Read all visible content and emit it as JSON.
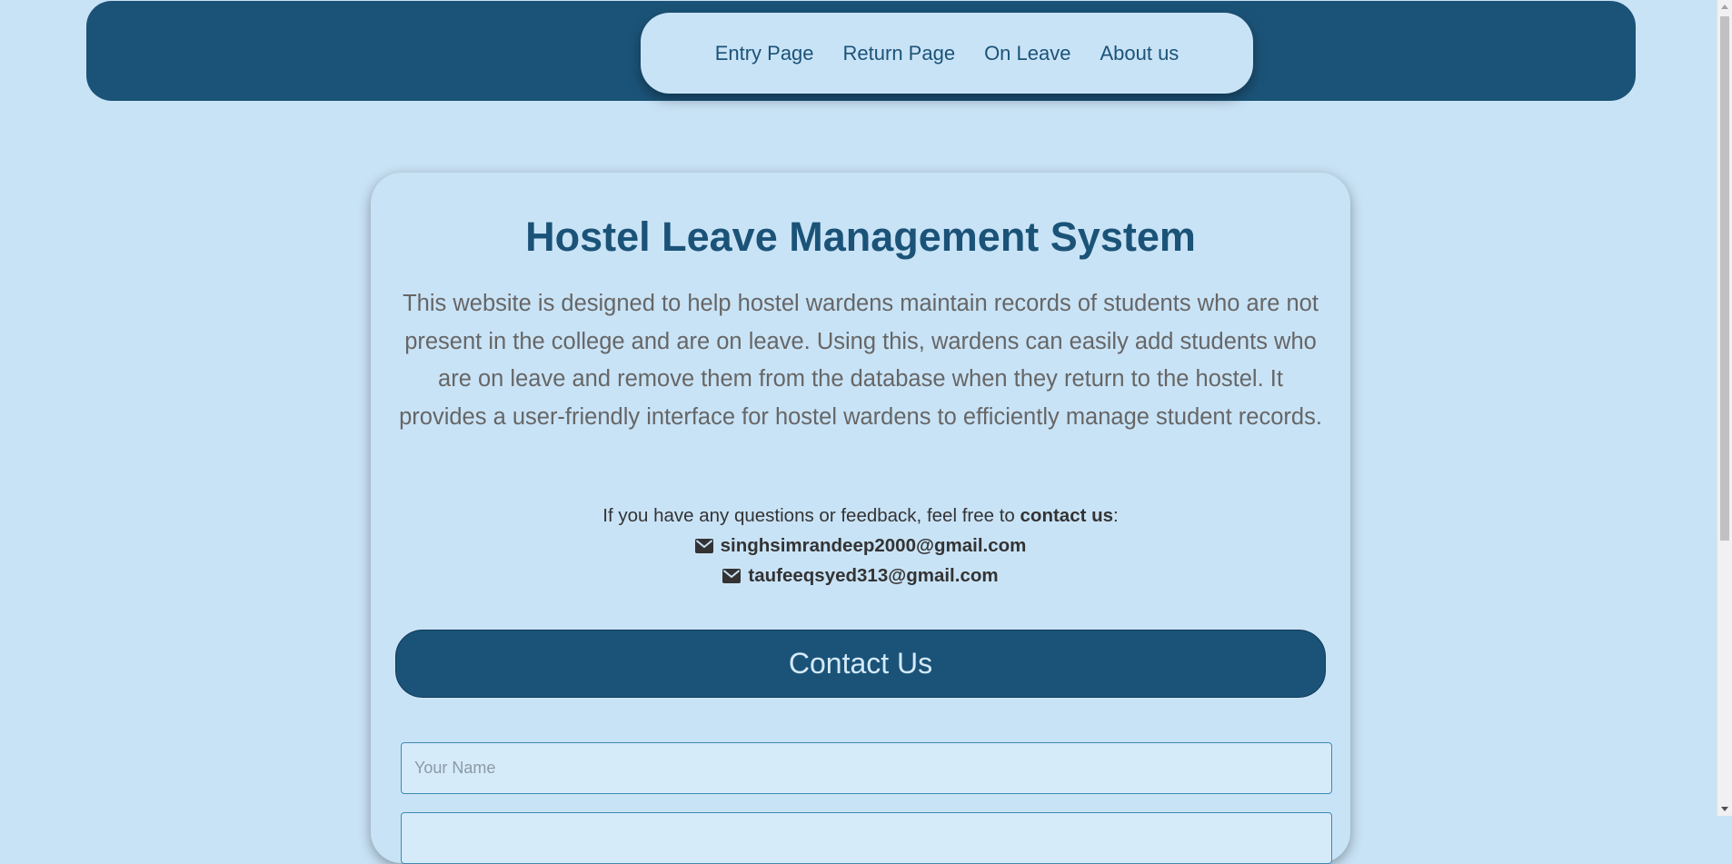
{
  "nav": {
    "items": [
      {
        "label": "Entry Page"
      },
      {
        "label": "Return Page"
      },
      {
        "label": "On Leave"
      },
      {
        "label": "About us"
      }
    ]
  },
  "main": {
    "title": "Hostel Leave Management System",
    "description": "This website is designed to help hostel wardens maintain records of students who are not present in the college and are on leave. Using this, wardens can easily add students who are on leave and remove them from the database when they return to the hostel. It provides a user-friendly interface for hostel wardens to efficiently manage student records.",
    "contact_intro": "If you have any questions or feedback, feel free to ",
    "contact_intro_bold": "contact us",
    "contact_intro_end": ":",
    "emails": [
      "singhsimrandeep2000@gmail.com",
      "taufeeqsyed313@gmail.com"
    ]
  },
  "contact_form": {
    "button_label": "Contact Us",
    "name_placeholder": "Your Name",
    "name_value": ""
  },
  "icons": {
    "email": "envelope-icon"
  },
  "colors": {
    "primary": "#1b5378",
    "background": "#c9e3f6"
  }
}
